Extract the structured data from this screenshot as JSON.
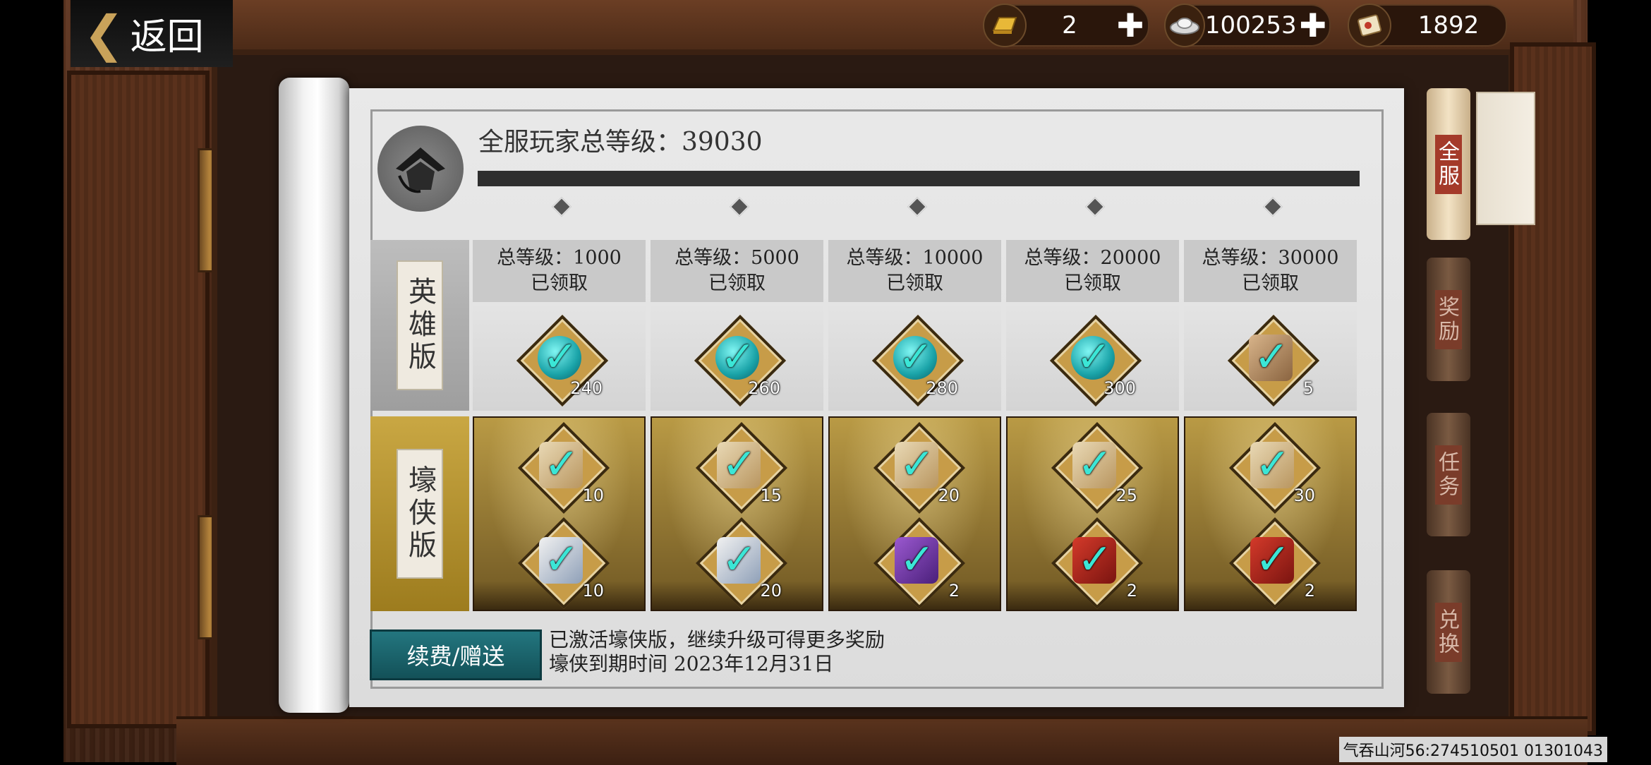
{
  "header": {
    "back_label": "返回"
  },
  "currencies": [
    {
      "name": "gold-ingot-icon",
      "value": "2",
      "has_plus": true
    },
    {
      "name": "silver-ingot-icon",
      "value": "100253",
      "has_plus": true
    },
    {
      "name": "scroll-ticket-icon",
      "value": "1892",
      "has_plus": false
    }
  ],
  "progress": {
    "title": "全服玩家总等级：39030",
    "total_level": 39030,
    "fill_fraction": 1.0
  },
  "rows": {
    "hero_label": "英雄版",
    "luxury_label": "壕侠版"
  },
  "tiers": [
    {
      "level_text": "总等级：1000",
      "status": "已领取",
      "hero": {
        "icon": "jade-token-icon",
        "qty": "240"
      },
      "lux1": {
        "icon": "scroll-bundle-icon",
        "qty": "10"
      },
      "lux2": {
        "icon": "silver-bundle-icon",
        "qty": "10"
      }
    },
    {
      "level_text": "总等级：5000",
      "status": "已领取",
      "hero": {
        "icon": "jade-token-icon",
        "qty": "260"
      },
      "lux1": {
        "icon": "scroll-bundle-icon",
        "qty": "15"
      },
      "lux2": {
        "icon": "silver-bundle-icon",
        "qty": "20"
      }
    },
    {
      "level_text": "总等级：10000",
      "status": "已领取",
      "hero": {
        "icon": "jade-token-icon",
        "qty": "280"
      },
      "lux1": {
        "icon": "scroll-bundle-icon",
        "qty": "20"
      },
      "lux2": {
        "icon": "purple-chest-icon",
        "qty": "2"
      }
    },
    {
      "level_text": "总等级：20000",
      "status": "已领取",
      "hero": {
        "icon": "jade-token-icon",
        "qty": "300"
      },
      "lux1": {
        "icon": "scroll-bundle-icon",
        "qty": "25"
      },
      "lux2": {
        "icon": "red-gift-box-icon",
        "qty": "2"
      }
    },
    {
      "level_text": "总等级：30000",
      "status": "已领取",
      "hero": {
        "icon": "cat-pet-icon",
        "qty": "5"
      },
      "lux1": {
        "icon": "scroll-bundle-icon",
        "qty": "30"
      },
      "lux2": {
        "icon": "red-gift-box-icon",
        "qty": "2"
      }
    }
  ],
  "footer": {
    "renew_button": "续费/赠送",
    "info_line1": "已激活壕侠版，继续升级可得更多奖励",
    "info_line2": "壕侠到期时间  2023年12月31日"
  },
  "side_tabs": [
    {
      "label": "全服",
      "active": true
    },
    {
      "label": "奖励",
      "active": false
    },
    {
      "label": "任务",
      "active": false
    },
    {
      "label": "兑换",
      "active": false
    }
  ],
  "server_id": "气吞山河56:274510501  01301043",
  "colors": {
    "teal_button": "#1b6b74",
    "check": "#3be6d6",
    "gold_row": "#b99a45"
  }
}
